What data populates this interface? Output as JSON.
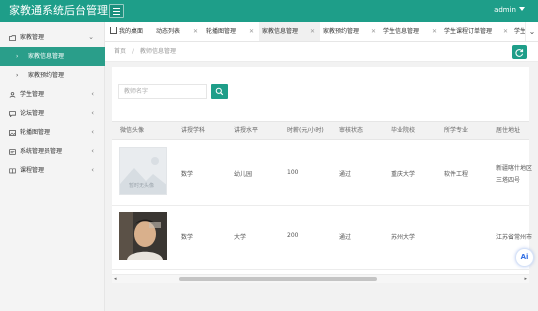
{
  "header": {
    "brand": "家教通系统后台管理",
    "user": "admin"
  },
  "sidebar": {
    "items": [
      {
        "label": "家教管理",
        "arrow": "⌄",
        "children": [
          {
            "label": "家教信息管理",
            "active": true
          },
          {
            "label": "家教预约管理",
            "active": false
          }
        ]
      },
      {
        "label": "学生管理",
        "arrow": "‹"
      },
      {
        "label": "论坛管理",
        "arrow": "‹"
      },
      {
        "label": "轮播图管理",
        "arrow": "‹"
      },
      {
        "label": "系统管理员管理",
        "arrow": "‹"
      },
      {
        "label": "课程管理",
        "arrow": "‹"
      }
    ]
  },
  "tabs": [
    {
      "label": "我的桌面",
      "closable": false
    },
    {
      "label": "动态列表",
      "closable": true
    },
    {
      "label": "轮播图管理",
      "closable": true
    },
    {
      "label": "家教信息管理",
      "closable": true,
      "active": true
    },
    {
      "label": "家教预约管理",
      "closable": true
    },
    {
      "label": "学生信息管理",
      "closable": true
    },
    {
      "label": "学生课程订单管理",
      "closable": true
    },
    {
      "label": "学生",
      "closable": false
    }
  ],
  "tab_close_glyph": "✕",
  "tab_scroll_glyph": "⌄",
  "breadcrumb": {
    "home": "首页",
    "separator": "/",
    "current": "教师信息管理"
  },
  "search": {
    "placeholder": "教师名字"
  },
  "table": {
    "columns": [
      "微信头像",
      "讲授学科",
      "讲授水平",
      "时薪(元/小时)",
      "审核状态",
      "毕业院校",
      "所学专业",
      "居住地址"
    ],
    "rows": [
      {
        "subject": "数学",
        "level": "幼儿园",
        "wage": "100",
        "status": "通过",
        "school": "重庆大学",
        "major": "软件工程",
        "address_line1": "新疆喀什地区",
        "address_line2": "三塔四号",
        "avatar_caption": "暂时无头像"
      },
      {
        "subject": "数学",
        "level": "大学",
        "wage": "200",
        "status": "通过",
        "school": "苏州大学",
        "major": "",
        "address_line1": "江苏省常州市",
        "address_line2": ""
      }
    ]
  },
  "scrollbar": {
    "left_glyph": "◂",
    "right_glyph": "▸"
  },
  "ai_badge": "Ai",
  "icons": [
    "menu-icon",
    "caret-down-icon",
    "home-icon",
    "close-icon",
    "chevron-down-icon",
    "refresh-icon",
    "search-icon",
    "folder-icon",
    "users-icon",
    "chat-icon",
    "image-icon",
    "admin-icon",
    "book-icon"
  ],
  "colors": {
    "brand": "#1e9e89",
    "sidebar_active": "#2a9e8a"
  }
}
